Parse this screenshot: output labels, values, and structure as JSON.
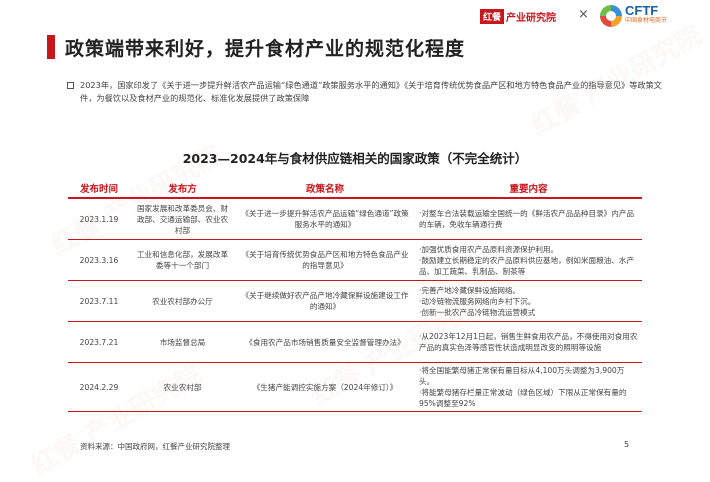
{
  "header": {
    "logo_red_box": "红餐",
    "logo_red_text": "产业研究院",
    "separator": "×",
    "logo_cftf": "CFTF",
    "logo_cftf_sub": "中国食材电商节"
  },
  "title": "政策端带来利好，提升食材产业的规范化程度",
  "intro": "2023年，国家印发了《关于进一步提升鲜活农产品运输“绿色通道”政策服务水平的通知》《关于培育传统优势食品产区和地方特色食品产业的指导意见》等政策文件，为餐饮以及食材产业的规范化、标准化发展提供了政策保障",
  "table": {
    "title": "2023—2024年与食材供应链相关的国家政策（不完全统计）",
    "headers": [
      "发布时间",
      "发布方",
      "政策名称",
      "重要内容"
    ],
    "rows": [
      {
        "date": "2023.1.19",
        "issuer": "国家发展和改革委员会、财政部、交通运输部、农业农村部",
        "policy": "《关于进一步提升鲜活农产品运输“绿色通道”政策服务水平的通知》",
        "content": [
          "·对整车合法装载运输全国统一的《鲜活农产品品种目录》内产品的车辆，免收车辆通行费"
        ]
      },
      {
        "date": "2023.3.16",
        "issuer": "工业和信息化部，发展改革委等十一个部门",
        "policy": "《关于培育传统优势食品产区和地方特色食品产业的指导意见》",
        "content": [
          "·加强优质食用农产品原料资源保护利用。",
          "·鼓励建立长期稳定的农产品原料供应基地，例如米面粮油、水产品、加工蔬菜、乳制品、制茶等"
        ]
      },
      {
        "date": "2023.7.11",
        "issuer": "农业农村部办公厅",
        "policy": "《关于继续做好农产品产地冷藏保鲜设施建设工作的通知》",
        "content": [
          "·完善产地冷藏保鲜设施网络。",
          "·动冷链物流服务网络向乡村下沉。",
          "·创新一批农产品冷链物流运营模式"
        ]
      },
      {
        "date": "2023.7.21",
        "issuer": "市场监督总局",
        "policy": "《食用农产品市场销售质量安全监督管理办法》",
        "content": [
          "·从2023年12月1日起，销售生鲜食用农产品，不得使用对食用农产品的真实色泽等感官性状造成明显改变的照明等设施"
        ]
      },
      {
        "date": "2024.2.29",
        "issuer": "农业农村部",
        "policy": "《生猪产能调控实施方案（2024年修订）》",
        "content": [
          "·将全国能繁母猪正常保有量目标从4,100万头调整为3,900万头。",
          "·将能繁母猪存栏量正常波动（绿色区域）下限从正常保有量的95%调整至92%"
        ]
      }
    ]
  },
  "footer": {
    "source": "资料来源：中国政府网，红餐产业研究院整理",
    "page": "5"
  },
  "watermark": "红餐 产业研究院"
}
